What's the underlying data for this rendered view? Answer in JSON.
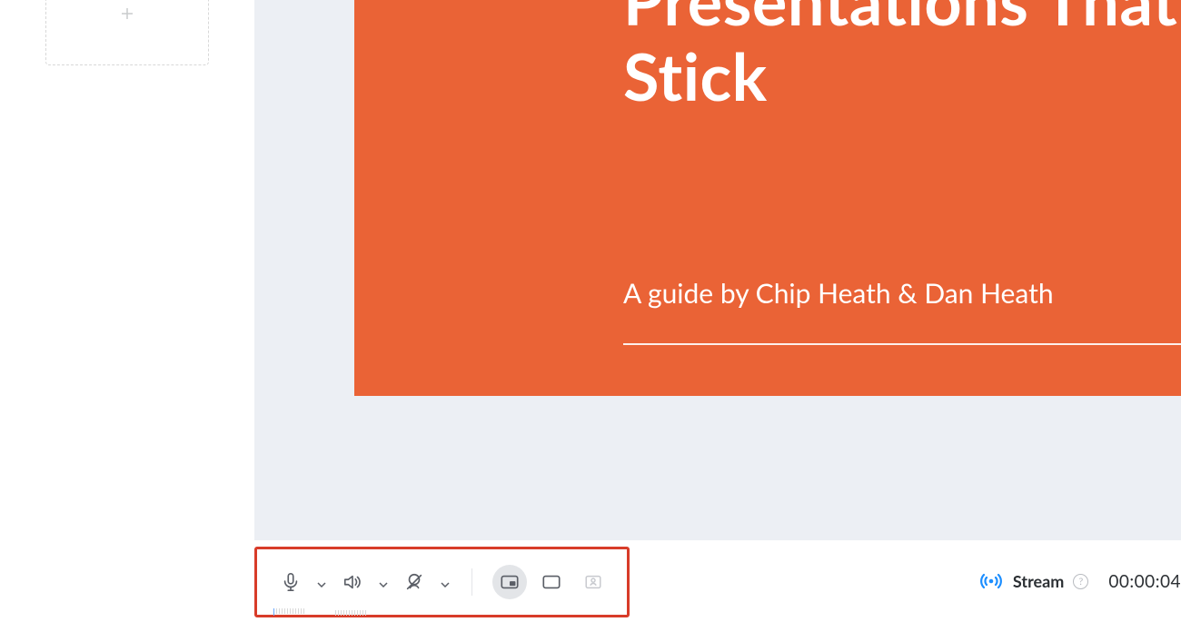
{
  "slide": {
    "title": "Presentations That\nStick",
    "subtitle": "A guide by Chip Heath & Dan Heath"
  },
  "toolbar": {
    "stream_label": "Stream",
    "help_glyph": "?",
    "timer": "00:00:04"
  },
  "icons": {
    "add_slide": "plus-icon",
    "mic": "microphone-icon",
    "speaker": "speaker-icon",
    "camera_off": "camera-off-icon",
    "layout_pip": "layout-pip-icon",
    "layout_full": "layout-full-icon",
    "layout_speaker": "layout-speaker-icon",
    "stream": "broadcast-icon"
  },
  "colors": {
    "accent": "#EA6336",
    "stream": "#1C8EFF",
    "highlight_border": "#D83C29"
  }
}
